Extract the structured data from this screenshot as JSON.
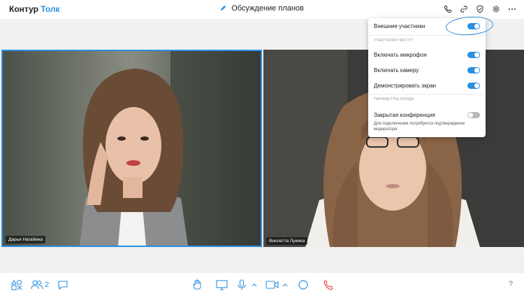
{
  "app": {
    "logo_part1": "Контур",
    "logo_part2": "Толк",
    "title": "Обсуждение планов"
  },
  "participants": [
    {
      "name": "Дарья Нагайина"
    },
    {
      "name": "Виолетта Лукина"
    }
  ],
  "panel": {
    "external": "Внешние участники",
    "section_can": "УЧАСТНИКИ МОГУТ",
    "mic": "Включать микрофон",
    "camera": "Включать камеру",
    "screen": "Демонстрировать экран",
    "section_entry": "ПАРАМЕТРЫ ВХОДА",
    "closed": "Закрытая конференция",
    "note": "Для подключения потребуется подтверждение модератора"
  },
  "toggles": {
    "external": true,
    "mic": true,
    "camera": true,
    "screen": true,
    "closed": false
  },
  "bottom": {
    "participants_count": "2",
    "help": "?"
  },
  "colors": {
    "accent": "#2b8fe0",
    "hangup": "#e8463f"
  }
}
